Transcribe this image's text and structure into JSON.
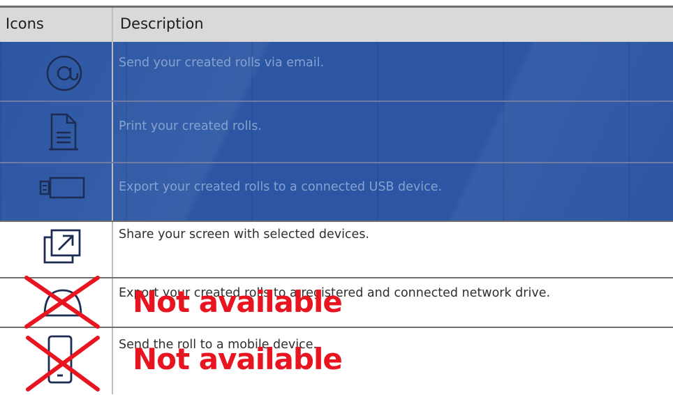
{
  "table": {
    "header": {
      "icons": "Icons",
      "description": "Description"
    },
    "rows": [
      {
        "icon": "at-sign-icon",
        "description": "Send your created rolls via email."
      },
      {
        "icon": "document-print-icon",
        "description": "Print your created rolls."
      },
      {
        "icon": "usb-export-icon",
        "description": "Export your created rolls to a connected USB device."
      },
      {
        "icon": "share-screen-icon",
        "description": "Share your screen with selected devices."
      },
      {
        "icon": "network-drive-icon",
        "description": "Export your created rolls to a registered and connected network drive."
      },
      {
        "icon": "mobile-device-icon",
        "description": "Send the roll to a mobile device."
      }
    ]
  },
  "annotations": {
    "not_available_1": "Not available",
    "not_available_2": "Not available"
  },
  "colors": {
    "overlay_blue": "#2c56a4",
    "header_gray": "#d9d9d9",
    "annotation_red": "#e8141f"
  }
}
